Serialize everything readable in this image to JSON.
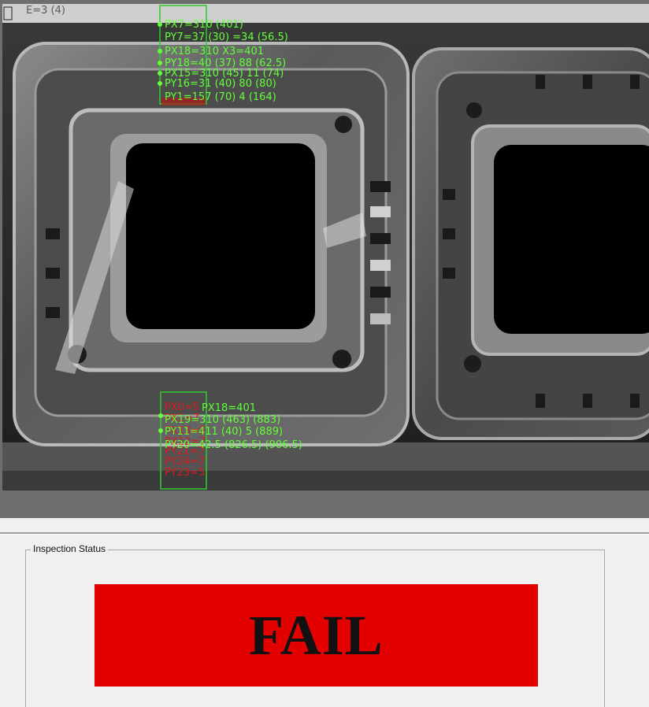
{
  "camera": {
    "frame_label": "E=3 (4)",
    "overlay_green_top": [
      "PX7=310 (401)",
      "PY7=37 (30) =34 (56.5)",
      "PX18=310 X3=401",
      "PY18=40 (37) 88 (62.5)",
      "PX15=310 (45) 11 (74)",
      "PY16=31 (40) 80 (80)",
      "PY1=157 (70) 4 (164)"
    ],
    "overlay_green_bottom": [
      "PX18=401",
      "PX19=310 (463) (883)",
      "PY11=411 (40) 5 (889)",
      "PY20=42.5 (826.5) (906.5)"
    ],
    "overlay_red_bottom": [
      "PX0=5",
      "PX1=7",
      "PX13=5",
      "PX12=7",
      "PY21=7",
      "PY24=7",
      "PY23=5"
    ]
  },
  "status": {
    "group_label": "Inspection Status",
    "result": "FAIL",
    "result_color": "#e30000"
  }
}
